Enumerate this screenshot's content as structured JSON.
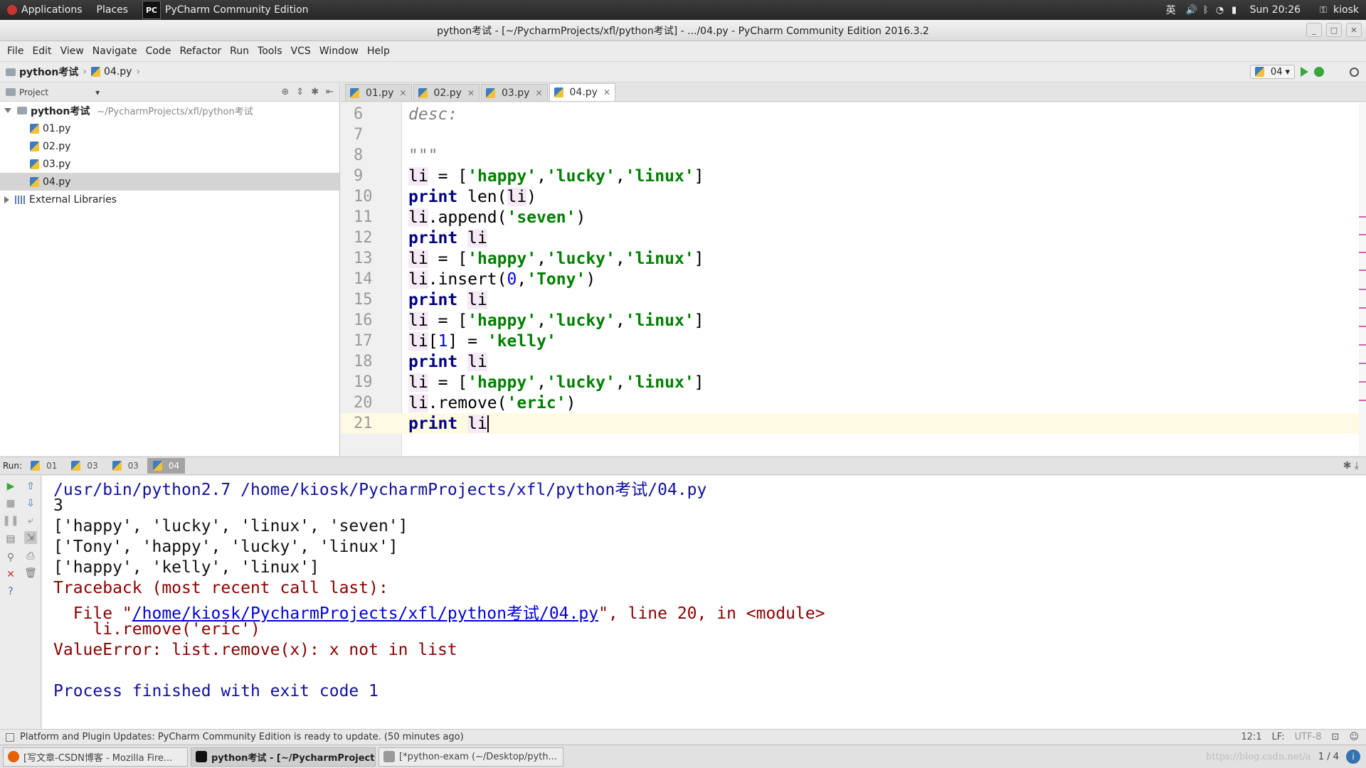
{
  "topbar": {
    "applications": "Applications",
    "places": "Places",
    "app_name": "PyCharm Community Edition",
    "logo_text": "PC",
    "input_method": "英",
    "clock": "Sun 20:26",
    "user": "kiosk"
  },
  "window": {
    "title": "python考试 - [~/PycharmProjects/xfl/python考试] - .../04.py - PyCharm Community Edition 2016.3.2"
  },
  "menu": [
    "File",
    "Edit",
    "View",
    "Navigate",
    "Code",
    "Refactor",
    "Run",
    "Tools",
    "VCS",
    "Window",
    "Help"
  ],
  "breadcrumb": {
    "project": "python考试",
    "file": "04.py"
  },
  "run_config": {
    "name": "04"
  },
  "project_panel": {
    "header": "Project",
    "root": "python考试",
    "root_path": "~/PycharmProjects/xfl/python考试",
    "files": [
      "01.py",
      "02.py",
      "03.py",
      "04.py"
    ],
    "selected_file": "04.py",
    "external": "External Libraries"
  },
  "editor_tabs": [
    "01.py",
    "02.py",
    "03.py",
    "04.py"
  ],
  "active_tab": "04.py",
  "code_lines": [
    {
      "n": "6",
      "text": "desc:"
    },
    {
      "n": "7",
      "text": ""
    },
    {
      "n": "8",
      "text": "\"\"\""
    },
    {
      "n": "9",
      "text": "li = ['happy','lucky','linux']"
    },
    {
      "n": "10",
      "text": "print len(li)"
    },
    {
      "n": "11",
      "text": "li.append('seven')"
    },
    {
      "n": "12",
      "text": "print li"
    },
    {
      "n": "13",
      "text": "li = ['happy','lucky','linux']"
    },
    {
      "n": "14",
      "text": "li.insert(0,'Tony')"
    },
    {
      "n": "15",
      "text": "print li"
    },
    {
      "n": "16",
      "text": "li = ['happy','lucky','linux']"
    },
    {
      "n": "17",
      "text": "li[1] = 'kelly'"
    },
    {
      "n": "18",
      "text": "print li"
    },
    {
      "n": "19",
      "text": "li = ['happy','lucky','linux']"
    },
    {
      "n": "20",
      "text": "li.remove('eric')"
    },
    {
      "n": "21",
      "text": "print li"
    }
  ],
  "run_panel": {
    "label": "Run:",
    "tabs": [
      "01",
      "03",
      "03",
      "04"
    ],
    "active_tab": "04"
  },
  "console": {
    "command": "/usr/bin/python2.7 /home/kiosk/PycharmProjects/xfl/python考试/04.py",
    "out1": "3",
    "out2": "['happy', 'lucky', 'linux', 'seven']",
    "out3": "['Tony', 'happy', 'lucky', 'linux']",
    "out4": "['happy', 'kelly', 'linux']",
    "tb_header": "Traceback (most recent call last):",
    "tb_file_prefix": "  File \"",
    "tb_file_link": "/home/kiosk/PycharmProjects/xfl/python考试/04.py",
    "tb_file_suffix": "\", line 20, in <module>",
    "tb_code": "    li.remove('eric')",
    "error": "ValueError: list.remove(x): x not in list",
    "finished": "Process finished with exit code 1"
  },
  "statusbar": {
    "message": "Platform and Plugin Updates: PyCharm Community Edition is ready to update. (50 minutes ago)",
    "position": "12:1",
    "line_sep": "LF:",
    "encoding": "UTF-8"
  },
  "taskbar": {
    "tasks": [
      "[写文章-CSDN博客 - Mozilla Fire...",
      "python考试 - [~/PycharmProject...",
      "[*python-exam (~/Desktop/pyth..."
    ],
    "watermark": "https://blog.csdn.net/a",
    "pager": "1 / 4"
  }
}
